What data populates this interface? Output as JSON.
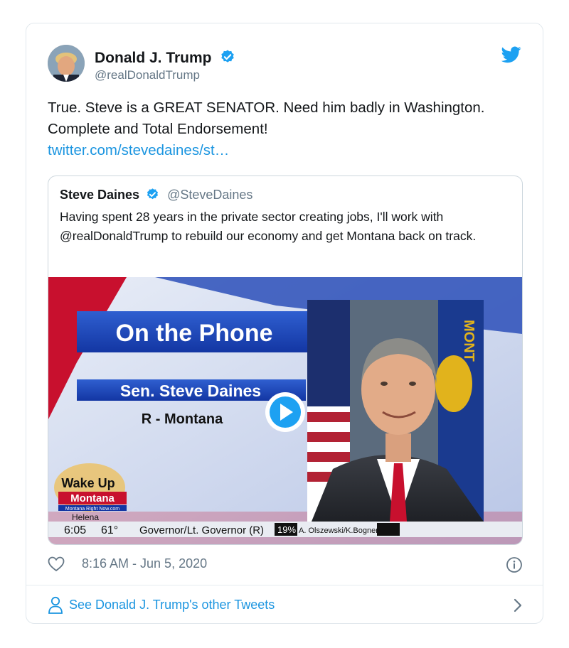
{
  "tweet": {
    "author_name": "Donald J. Trump",
    "author_handle": "@realDonaldTrump",
    "text": "True. Steve is a GREAT SENATOR. Need him badly in Washington. Complete and Total Endorsement!",
    "link_text": "twitter.com/stevedaines/st…",
    "timestamp": "8:16 AM - Jun 5, 2020",
    "accent_color": "#1da1f2"
  },
  "quoted_tweet": {
    "author_name": "Steve Daines",
    "author_handle": "@SteveDaines",
    "text": "Having spent 28 years in the private sector creating jobs, I'll work with @realDonaldTrump to rebuild our economy and get Montana back on track."
  },
  "video": {
    "banner_title": "On the Phone",
    "name_label": "Sen. Steve Daines",
    "party_label": "R - Montana",
    "logo_line1": "Wake Up",
    "logo_line2": "Montana",
    "logo_sub": "Montana Right Now.com",
    "location": "Helena",
    "time": "6:05",
    "temperature": "61°",
    "ticker_race": "Governor/Lt. Governor (R)",
    "ticker_percent": "19%",
    "ticker_names": "A. Olszewski/K.Bogner",
    "flag_text": "MONT"
  },
  "footer": {
    "see_more_label": "See Donald J. Trump's other Tweets"
  },
  "icons": {
    "verified": "verified-badge-icon",
    "bird": "twitter-bird-icon",
    "heart": "heart-icon",
    "info": "info-icon",
    "person": "person-icon",
    "chevron": "chevron-right-icon",
    "play": "play-icon"
  }
}
